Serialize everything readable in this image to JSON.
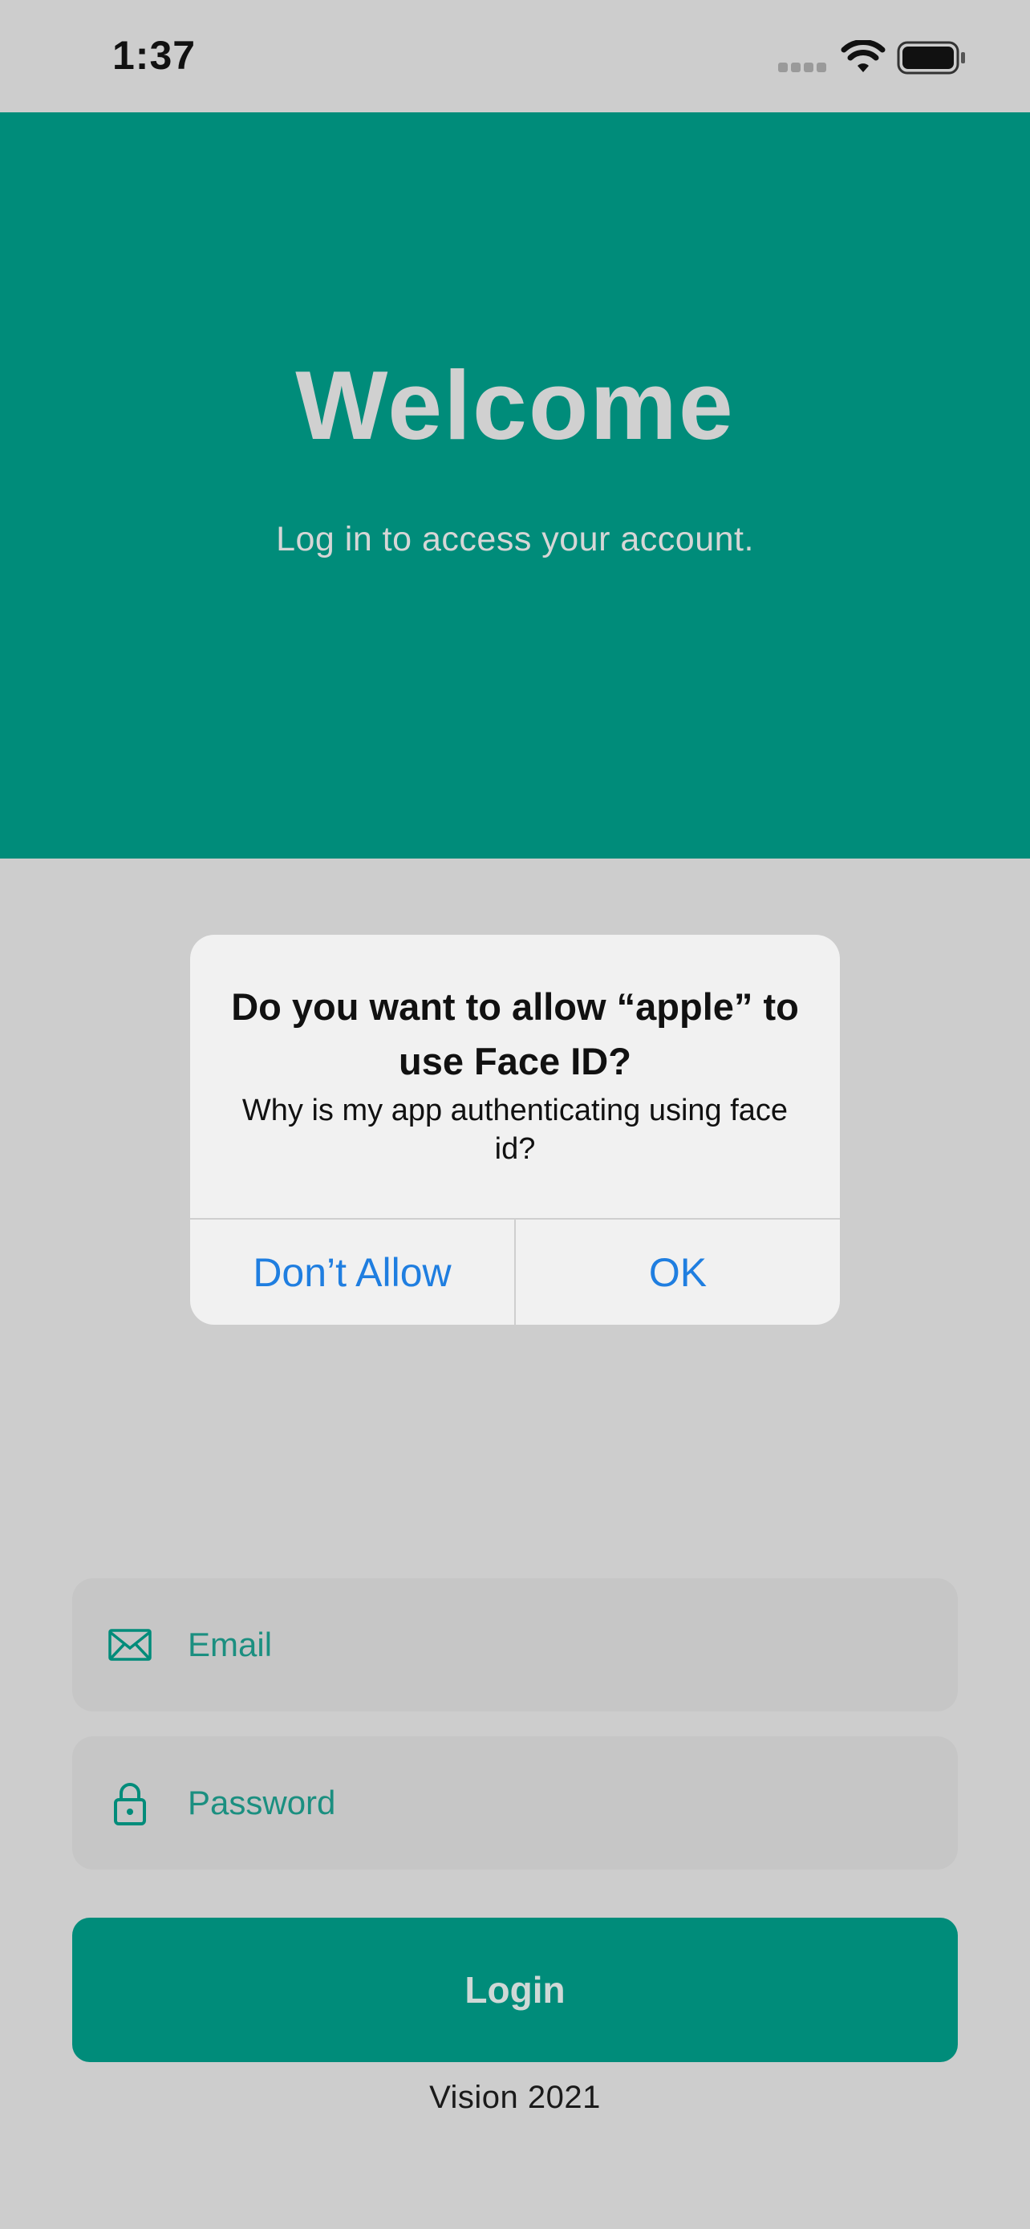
{
  "status_bar": {
    "time": "1:37",
    "icons": [
      "cellular-signal-icon",
      "wifi-icon",
      "battery-icon"
    ]
  },
  "header": {
    "title": "Welcome",
    "subtitle": "Log in to access your account."
  },
  "alert": {
    "title": "Do you want to allow “apple” to use Face ID?",
    "message": "Why is my app authenticating using face id?",
    "buttons": {
      "cancel": "Don’t Allow",
      "confirm": "OK"
    }
  },
  "form": {
    "email": {
      "placeholder": "Email",
      "value": "",
      "icon": "envelope-icon"
    },
    "password": {
      "placeholder": "Password",
      "value": "",
      "icon": "lock-icon"
    },
    "login_label": "Login"
  },
  "footer": {
    "text": "Vision 2021"
  },
  "colors": {
    "brand": "#008c7a",
    "background": "#cdcdcd",
    "alert_background": "#f1f1f1",
    "alert_button": "#1f7ee0",
    "input_background": "#c6c6c6"
  }
}
